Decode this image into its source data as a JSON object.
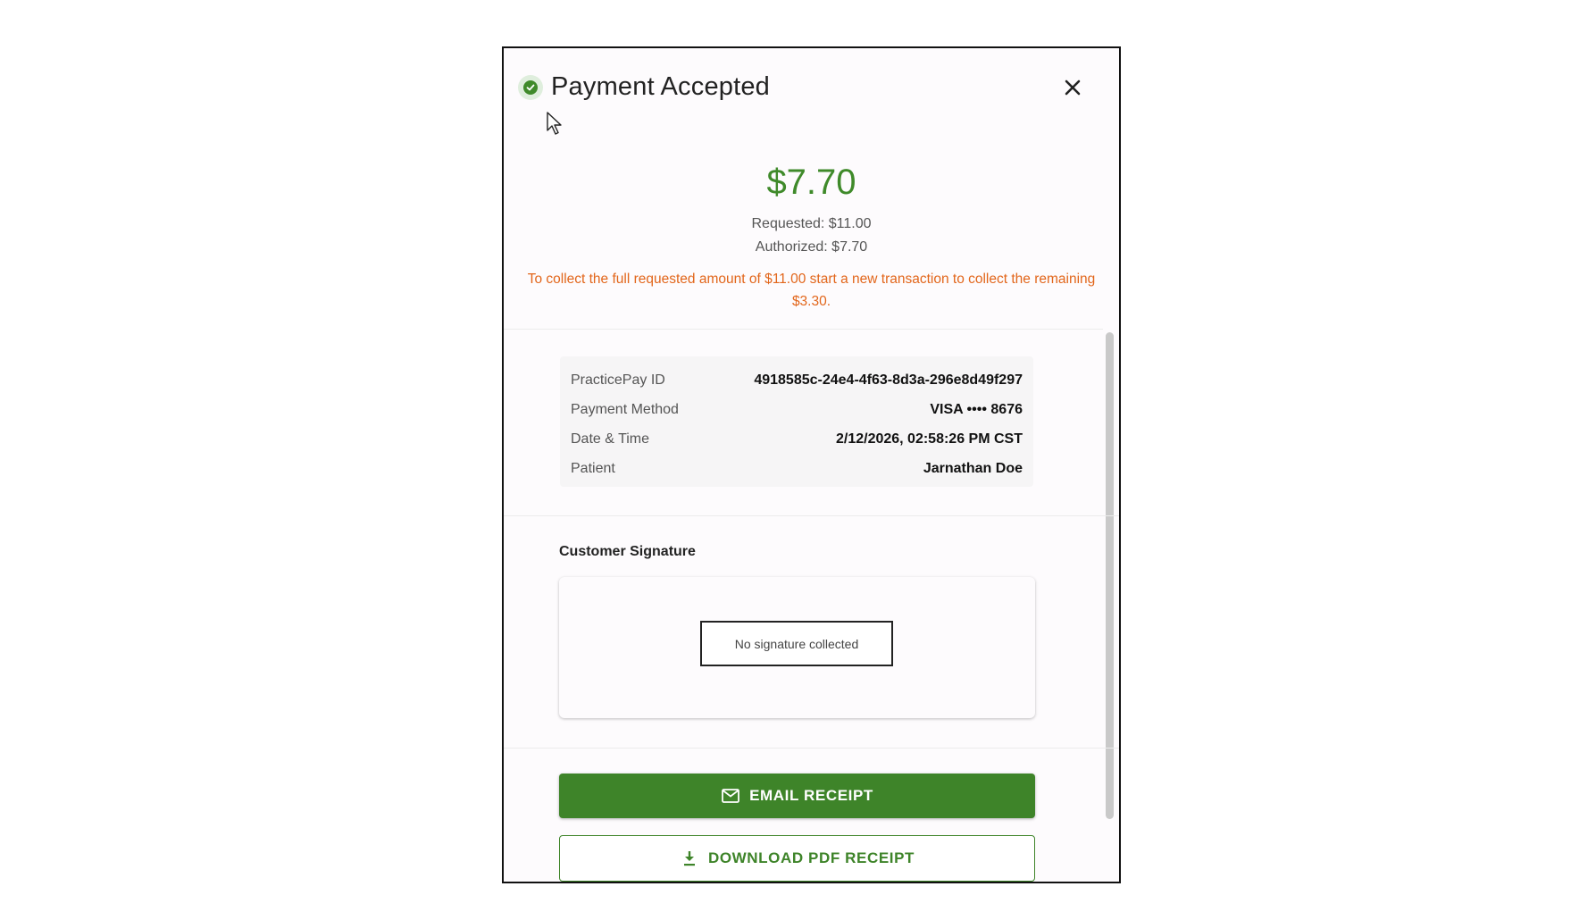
{
  "dialog": {
    "title": "Payment Accepted",
    "close_icon": "close-icon",
    "status_icon": "check-circle-icon"
  },
  "summary": {
    "amount": "$7.70",
    "requested": "Requested: $11.00",
    "authorized": "Authorized: $7.70",
    "warning": "To collect the full requested amount of $11.00 start a new transaction to collect the remaining $3.30."
  },
  "details": {
    "rows": [
      {
        "label": "PracticePay ID",
        "value": "4918585c-24e4-4f63-8d3a-296e8d49f297"
      },
      {
        "label": "Payment Method",
        "value": "VISA •••• 8676"
      },
      {
        "label": "Date & Time",
        "value": "2/12/2026, 02:58:26 PM CST"
      },
      {
        "label": "Patient",
        "value": "Jarnathan Doe"
      }
    ]
  },
  "signature": {
    "title": "Customer Signature",
    "empty_text": "No signature collected"
  },
  "actions": {
    "email_label": "EMAIL RECEIPT",
    "email_icon": "mail-icon",
    "download_label": "DOWNLOAD PDF RECEIPT",
    "download_icon": "download-icon"
  },
  "colors": {
    "accent": "#3e8429",
    "warning": "#e2661b"
  }
}
